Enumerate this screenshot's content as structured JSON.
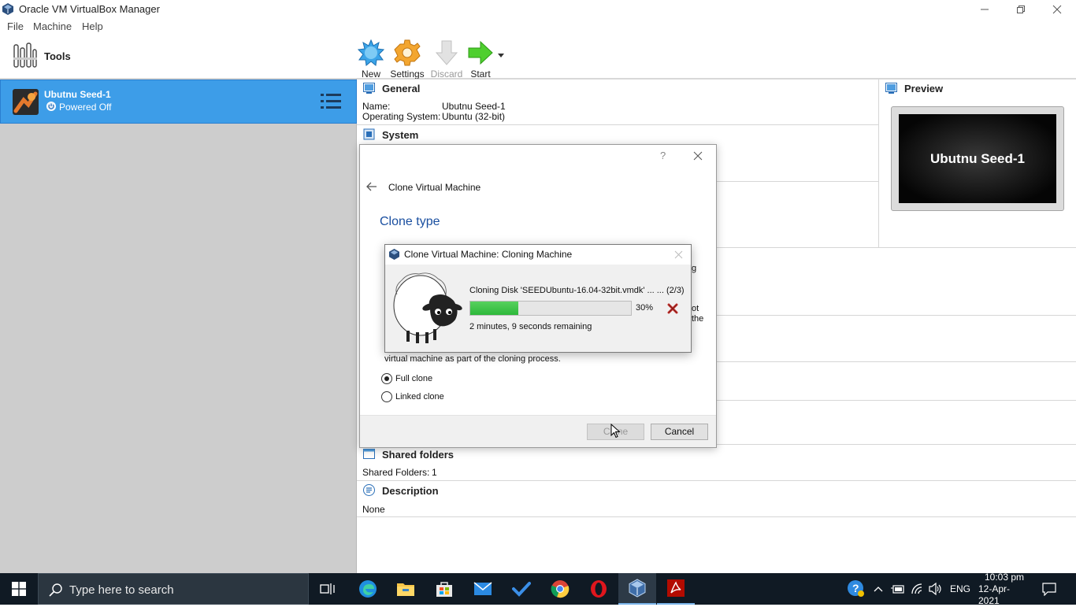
{
  "window": {
    "title": "Oracle VM VirtualBox Manager"
  },
  "menu": {
    "items": [
      "File",
      "Machine",
      "Help"
    ]
  },
  "tools": {
    "label": "Tools"
  },
  "vm": {
    "name": "Ubutnu Seed-1",
    "state": "Powered Off"
  },
  "toolbar": {
    "new": "New",
    "settings": "Settings",
    "discard": "Discard",
    "start": "Start"
  },
  "details": {
    "general": {
      "title": "General",
      "name_label": "Name:",
      "name_value": "Ubutnu Seed-1",
      "os_label": "Operating System:",
      "os_value": "Ubuntu (32-bit)"
    },
    "system": {
      "title": "System"
    },
    "shared": {
      "title": "Shared folders",
      "label": "Shared Folders:",
      "value": "1"
    },
    "description": {
      "title": "Description",
      "value": "None"
    },
    "preview": {
      "title": "Preview",
      "screen_text": "Ubutnu Seed-1"
    }
  },
  "clone_dialog": {
    "help": "?",
    "header": "Clone Virtual Machine",
    "section_title": "Clone type",
    "body_fragment": "virtual machine as part of the cloning process.",
    "frag_ot": "ot",
    "frag_the": "the",
    "frag_g": "g",
    "option_full": "Full clone",
    "option_linked": "Linked clone",
    "selected": "Full clone",
    "btn_clone": "Clone",
    "btn_cancel": "Cancel"
  },
  "progress_dialog": {
    "title": "Clone Virtual Machine: Cloning Machine",
    "operation": "Cloning Disk 'SEEDUbuntu-16.04-32bit.vmdk' ... ... (2/3)",
    "percent_text": "30%",
    "percent": 30,
    "remaining": "2 minutes, 9 seconds remaining"
  },
  "taskbar": {
    "search_placeholder": "Type here to search",
    "lang": "ENG",
    "time": "10:03 pm",
    "date": "12-Apr-2021"
  },
  "colors": {
    "selection": "#3d9de8",
    "accent_blue": "#1a4fa0",
    "progress": "#2db83a"
  }
}
